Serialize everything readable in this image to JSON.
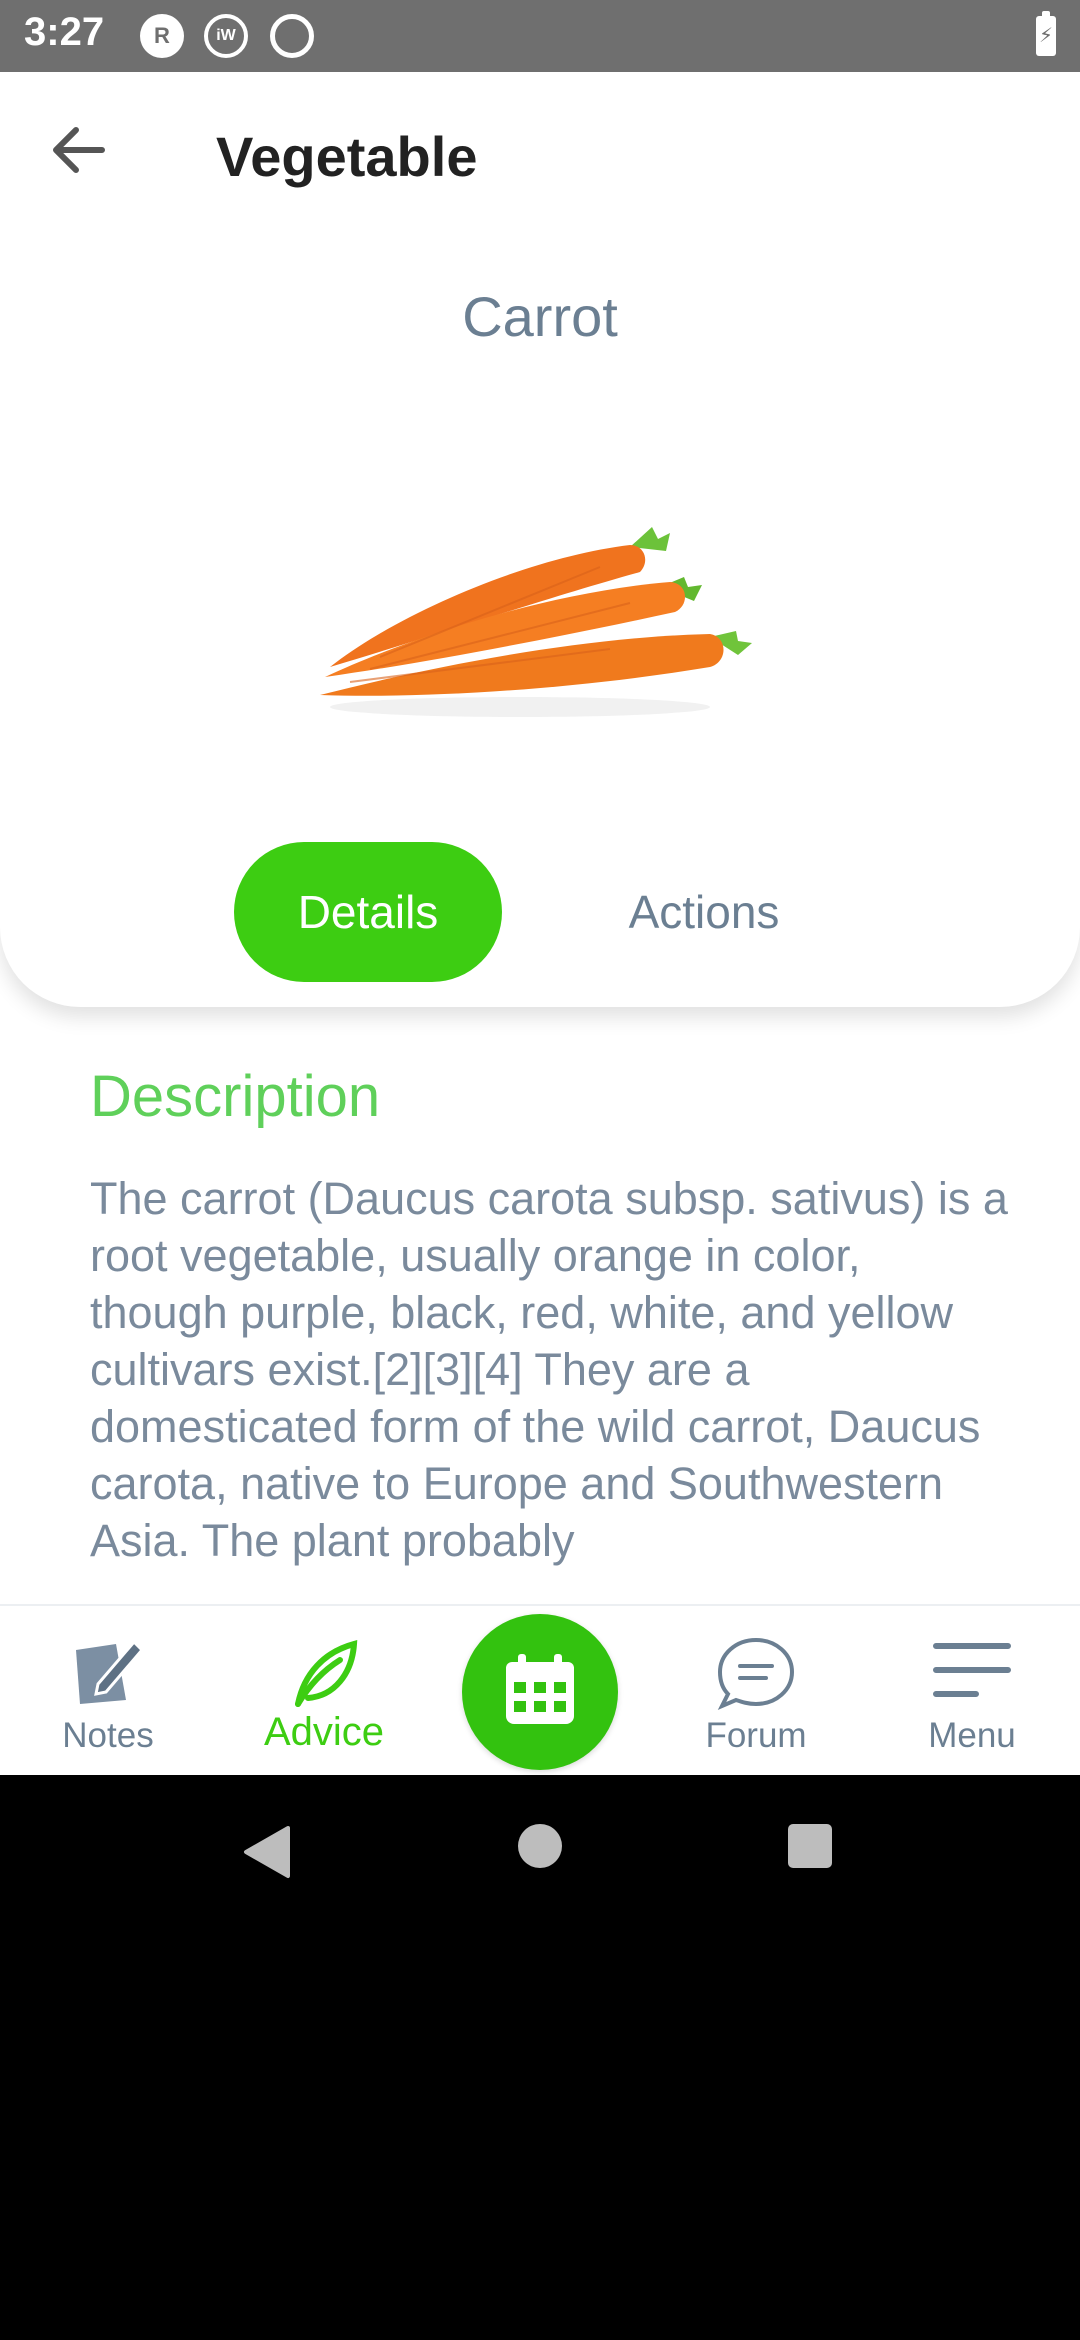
{
  "status_bar": {
    "time": "3:27",
    "icons": [
      "r-circle-icon",
      "iw-circle-icon",
      "q-circle-icon",
      "battery-charging-icon"
    ],
    "icon_letters": {
      "r": "R",
      "w": "iW"
    }
  },
  "toolbar": {
    "title": "Vegetable",
    "back_icon": "arrow-left-icon"
  },
  "item": {
    "name": "Carrot",
    "image": "carrot-image"
  },
  "tabs": [
    {
      "label": "Details",
      "active": true
    },
    {
      "label": "Actions",
      "active": false
    }
  ],
  "description": {
    "heading": "Description",
    "text": "The carrot (Daucus carota subsp. sativus) is a root vegetable, usually orange in color, though purple, black, red, white, and yellow cultivars exist.[2][3][4] They are a domesticated form of the wild carrot, Daucus carota, native to Europe and Southwestern Asia. The plant probably"
  },
  "bottom_nav": {
    "items": [
      {
        "label": "Notes",
        "icon": "notes-pencil-icon",
        "active": false
      },
      {
        "label": "Advice",
        "icon": "leaf-icon",
        "active": true
      },
      {
        "label": "",
        "icon": "calendar-icon",
        "active": false
      },
      {
        "label": "Forum",
        "icon": "chat-bubble-icon",
        "active": false
      },
      {
        "label": "Menu",
        "icon": "hamburger-menu-icon",
        "active": false
      }
    ]
  },
  "colors": {
    "accent_green": "#3dcd12",
    "heading_green": "#5fd05a",
    "text_gray": "#7a8a9c",
    "label_gray": "#6b7f92",
    "status_bar": "#6f6f6f"
  }
}
